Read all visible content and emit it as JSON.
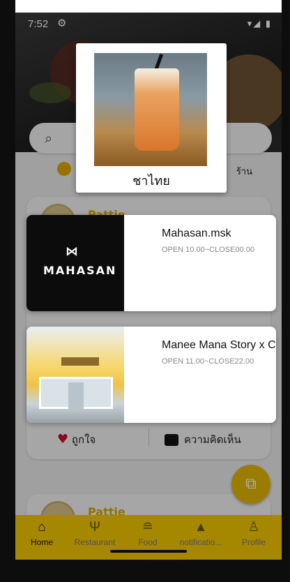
{
  "status": {
    "time": "7:52",
    "icons": "▾◢ ▮"
  },
  "search": {
    "placeholder": ""
  },
  "location": {
    "text": "ร้าน"
  },
  "feed": [
    {
      "username": "Pattie"
    },
    {
      "username": "Pattie"
    }
  ],
  "actions": {
    "like_label": "ถูกใจ",
    "comment_label": "ความคิดเห็น"
  },
  "popup": {
    "caption": "ชาไทย"
  },
  "shops": [
    {
      "name": "Mahasan.msk",
      "hours": "OPEN 10.00~CLOSE00.00",
      "logo_text": "MAHASAN",
      "logo_mark": "⋈"
    },
    {
      "name": "Manee Mana Story x C",
      "hours": "OPEN 11.00~CLOSE22.00"
    }
  ],
  "nav": [
    {
      "label": "Home",
      "icon": "home-icon",
      "active": true
    },
    {
      "label": "Restaurant",
      "icon": "restaurant-icon",
      "active": false
    },
    {
      "label": "Food",
      "icon": "food-icon",
      "active": false
    },
    {
      "label": "notificatio...",
      "icon": "bell-icon",
      "active": false
    },
    {
      "label": "Profile",
      "icon": "person-icon",
      "active": false
    }
  ],
  "colors": {
    "accent": "#f5c800",
    "like": "#c8102e",
    "username": "#d8a800"
  }
}
